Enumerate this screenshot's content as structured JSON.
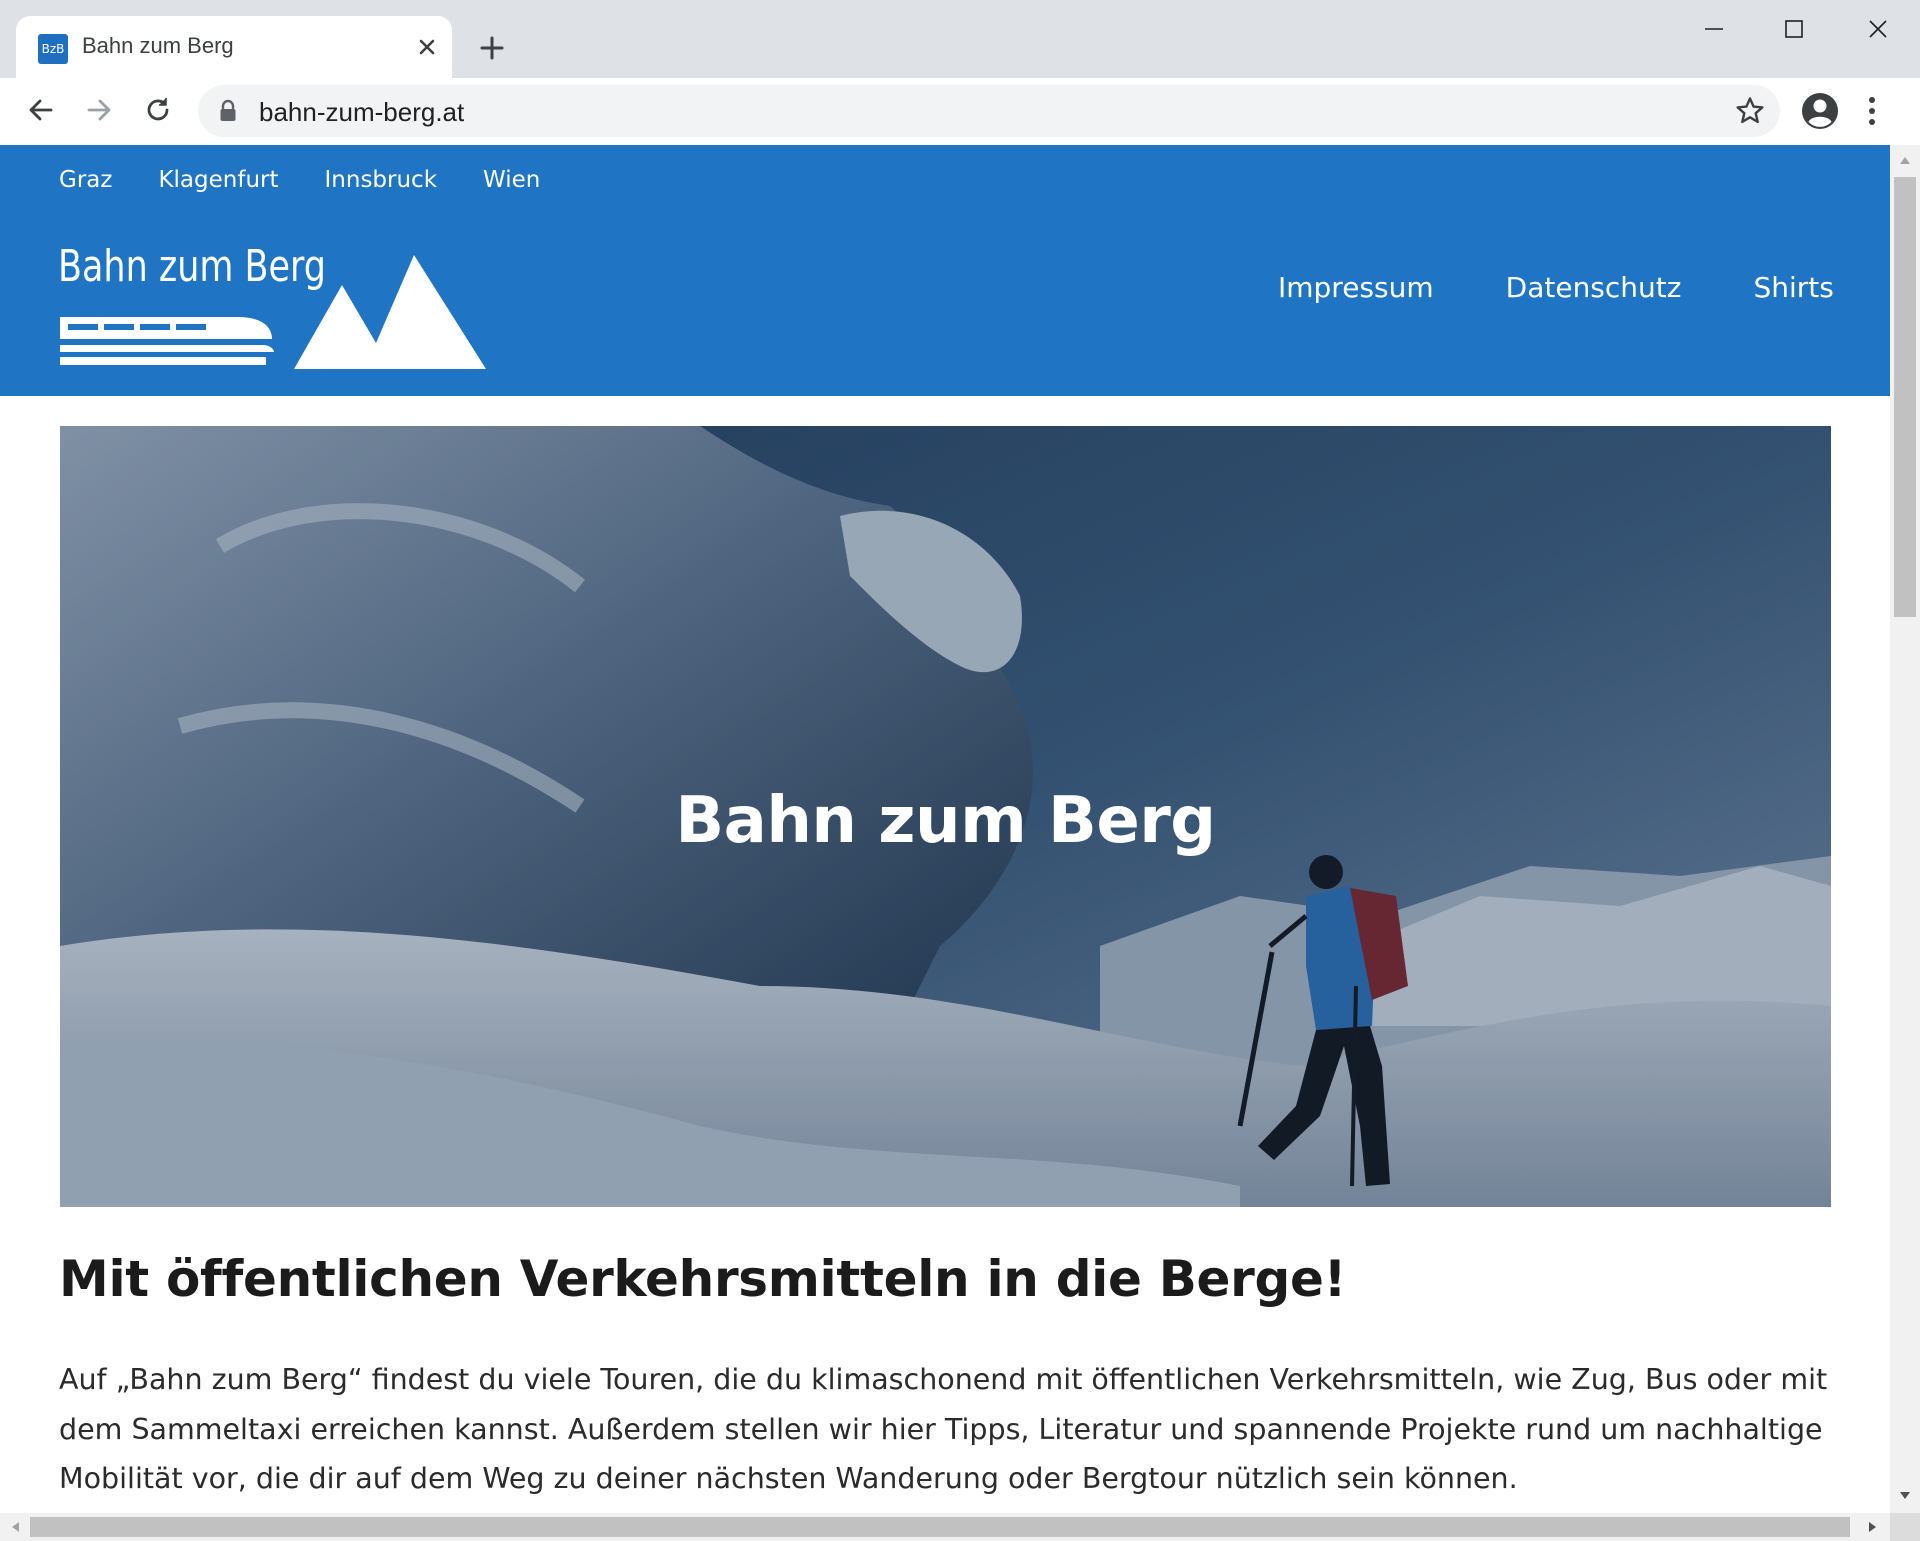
{
  "browser": {
    "tab_title": "Bahn zum Berg",
    "favicon_text": "BzB",
    "url": "bahn-zum-berg.at",
    "icons": [
      "close-icon",
      "plus-icon",
      "minimize-icon",
      "maximize-icon",
      "window-close-icon",
      "back-arrow-icon",
      "forward-arrow-icon",
      "reload-icon",
      "lock-icon",
      "star-icon",
      "profile-icon",
      "more-icon"
    ]
  },
  "site": {
    "city_nav": [
      "Graz",
      "Klagenfurt",
      "Innsbruck",
      "Wien"
    ],
    "logo_text": "Bahn zum Berg",
    "main_nav": [
      "Impressum",
      "Datenschutz",
      "Shirts"
    ],
    "hero_title": "Bahn zum Berg",
    "headline": "Mit öffentlichen Verkehrsmitteln in die Berge!",
    "intro": "Auf „Bahn zum Berg“ findest du viele Touren, die du klimaschonend mit öffentlichen Verkehrsmitteln, wie Zug, Bus oder mit dem Sammeltaxi erreichen kannst. Außerdem stellen wir hier Tipps, Literatur und spannende Projekte rund um nachhaltige Mobilität vor, die dir auf dem Weg zu deiner nächsten Wanderung oder Bergtour nützlich sein können."
  },
  "colors": {
    "header_blue": "#1f74c3",
    "chrome_gray": "#dee1e6",
    "text_dark": "#1b1b1b"
  }
}
